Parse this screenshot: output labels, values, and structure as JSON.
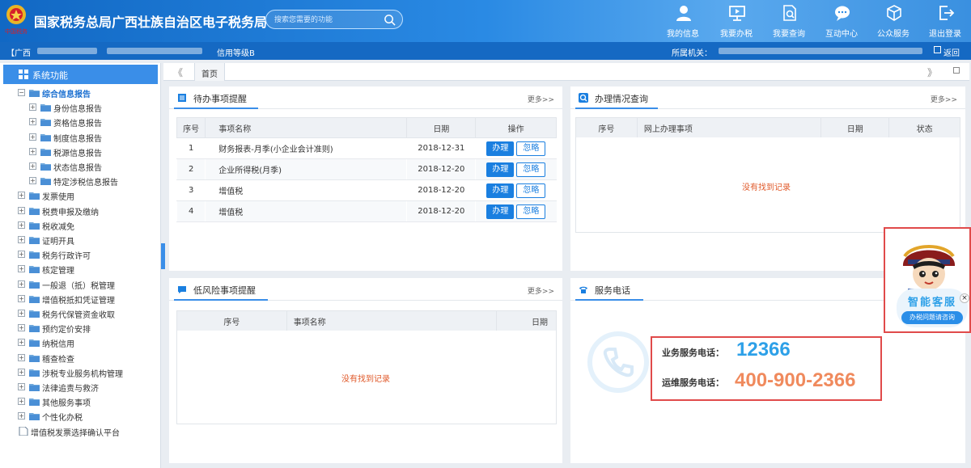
{
  "header": {
    "title": "国家税务总局广西壮族自治区电子税务局",
    "logo_text": "中国税务",
    "search": {
      "placeholder": "搜索您需要的功能"
    },
    "nav": [
      {
        "label": "我的信息",
        "icon": "user-icon"
      },
      {
        "label": "我要办税",
        "icon": "monitor-icon"
      },
      {
        "label": "我要查询",
        "icon": "document-search-icon"
      },
      {
        "label": "互动中心",
        "icon": "chat-bubble-icon"
      },
      {
        "label": "公众服务",
        "icon": "cube-icon"
      },
      {
        "label": "退出登录",
        "icon": "logout-icon"
      }
    ]
  },
  "infobar": {
    "prefix": "【广西",
    "credit": "信用等级B",
    "authority_label": "所属机关：",
    "back": "返回"
  },
  "sidebar": {
    "title": "系统功能",
    "tree": [
      {
        "label": "综合信息报告",
        "level": 0,
        "expanded": true,
        "selected": true
      },
      {
        "label": "身份信息报告",
        "level": 1
      },
      {
        "label": "资格信息报告",
        "level": 1
      },
      {
        "label": "制度信息报告",
        "level": 1
      },
      {
        "label": "税源信息报告",
        "level": 1
      },
      {
        "label": "状态信息报告",
        "level": 1
      },
      {
        "label": "特定涉税信息报告",
        "level": 1
      },
      {
        "label": "发票使用",
        "level": 0
      },
      {
        "label": "税费申报及缴纳",
        "level": 0
      },
      {
        "label": "税收减免",
        "level": 0
      },
      {
        "label": "证明开具",
        "level": 0
      },
      {
        "label": "税务行政许可",
        "level": 0
      },
      {
        "label": "核定管理",
        "level": 0
      },
      {
        "label": "一般退（抵）税管理",
        "level": 0
      },
      {
        "label": "增值税抵扣凭证管理",
        "level": 0
      },
      {
        "label": "税务代保管资金收取",
        "level": 0
      },
      {
        "label": "预约定价安排",
        "level": 0
      },
      {
        "label": "纳税信用",
        "level": 0
      },
      {
        "label": "稽查检查",
        "level": 0
      },
      {
        "label": "涉税专业服务机构管理",
        "level": 0
      },
      {
        "label": "法律追责与救济",
        "level": 0
      },
      {
        "label": "其他服务事项",
        "level": 0
      },
      {
        "label": "个性化办税",
        "level": 0
      },
      {
        "label": "增值税发票选择确认平台",
        "level": 0,
        "doc": true
      }
    ]
  },
  "tabs": {
    "items": [
      "首页"
    ],
    "left_arrow": "《",
    "right_arrow": "》"
  },
  "todo": {
    "title": "待办事项提醒",
    "more": "更多>>",
    "columns": [
      "序号",
      "事项名称",
      "日期",
      "操作"
    ],
    "rows": [
      {
        "no": "1",
        "name": "财务报表-月季(小企业会计准则)",
        "date": "2018-12-31"
      },
      {
        "no": "2",
        "name": "企业所得税(月季)",
        "date": "2018-12-20"
      },
      {
        "no": "3",
        "name": "增值税",
        "date": "2018-12-20"
      },
      {
        "no": "4",
        "name": "增值税",
        "date": "2018-12-20"
      }
    ],
    "do_label": "办理",
    "ignore_label": "忽略"
  },
  "status_query": {
    "title": "办理情况查询",
    "more": "更多>>",
    "columns": [
      "序号",
      "网上办理事项",
      "日期",
      "状态"
    ],
    "empty": "没有找到记录"
  },
  "low_risk": {
    "title": "低风险事项提醒",
    "more": "更多>>",
    "columns": [
      "序号",
      "事项名称",
      "日期"
    ],
    "empty": "没有找到记录"
  },
  "service_phone": {
    "title": "服务电话",
    "business_label": "业务服务电话：",
    "business_number": "12366",
    "ops_label": "运维服务电话：",
    "ops_number": "400-900-2366"
  },
  "assistant": {
    "title": "智能客服",
    "subtitle": "办税问题请咨询"
  },
  "colors": {
    "header_blue": "#1168c4",
    "accent": "#3a8ee8",
    "button_blue": "#1a7fe0",
    "empty_orange": "#e05a2b",
    "number_blue": "#2da0e8",
    "number_orange": "#f08a5d",
    "highlight_red": "#e04a4a"
  }
}
